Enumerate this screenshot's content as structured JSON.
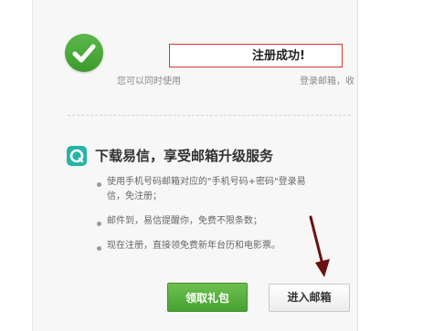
{
  "success": {
    "title": "注册成功!",
    "hint_left": "您可以同时使用",
    "hint_right": "登录邮箱，收"
  },
  "promo": {
    "icon": "yixin-app-icon",
    "title": "下载易信，享受邮箱升级服务",
    "bullets": [
      "使用手机号码邮箱对应的\"手机号码+密码\"登录易信，免注册；",
      "邮件到，易信提醒你，免费不限条数；",
      "现在注册，直接领免费新年台历和电影票。"
    ]
  },
  "buttons": {
    "gift_label": "领取礼包",
    "enter_label": "进入邮箱"
  },
  "colors": {
    "success_green": "#4aa83a",
    "highlight_red": "#e0332b",
    "yixin_teal": "#23b5a5",
    "annotation_arrow": "#6b1010"
  }
}
